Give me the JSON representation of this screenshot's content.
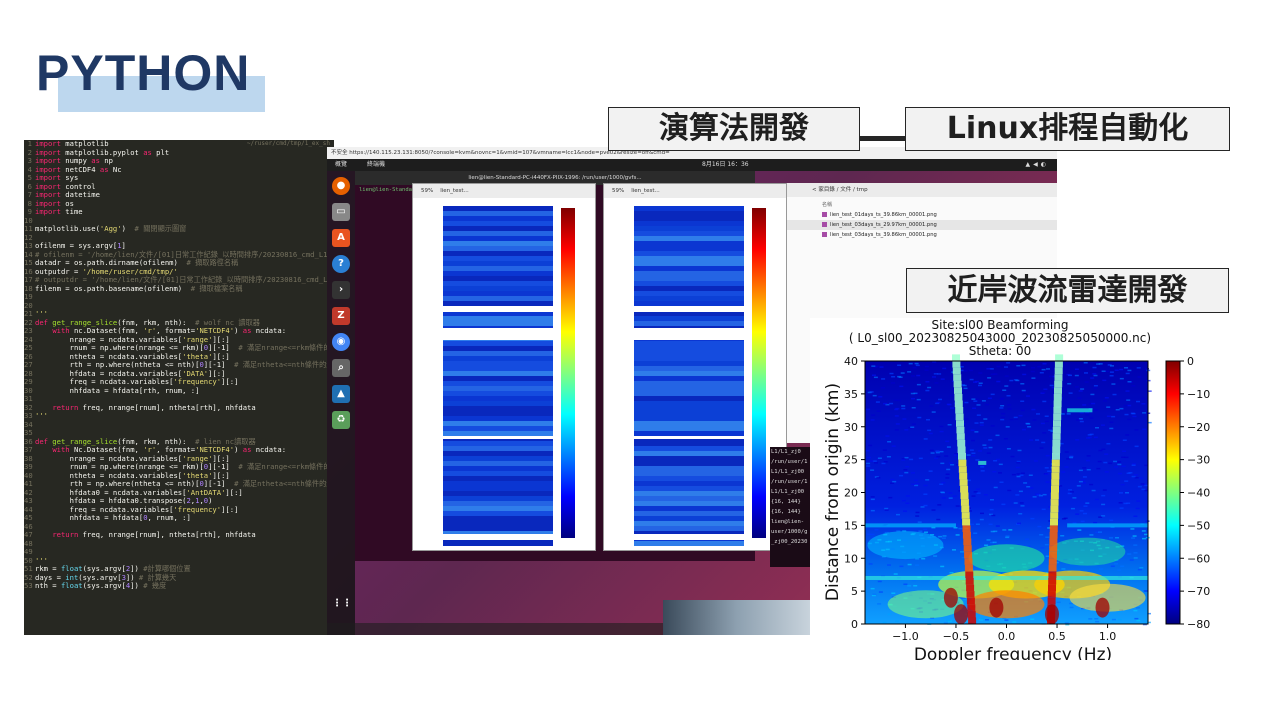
{
  "slide": {
    "title": "PYTHON",
    "labels": {
      "algorithm": "演算法開發",
      "linux_cron": "Linux排程自動化",
      "radar": "近岸波流雷達開發"
    }
  },
  "editor": {
    "header": "~/ruser/cmd/tmp/1_ex_sh",
    "lines": [
      [
        [
          "kw",
          "import"
        ],
        [
          "tx",
          " matplotlib"
        ]
      ],
      [
        [
          "kw",
          "import"
        ],
        [
          "tx",
          " matplotlib.pyplot "
        ],
        [
          "kw",
          "as"
        ],
        [
          "tx",
          " plt"
        ]
      ],
      [
        [
          "kw",
          "import"
        ],
        [
          "tx",
          " numpy "
        ],
        [
          "kw",
          "as"
        ],
        [
          "tx",
          " np"
        ]
      ],
      [
        [
          "kw",
          "import"
        ],
        [
          "tx",
          " netCDF4 "
        ],
        [
          "kw",
          "as"
        ],
        [
          "tx",
          " Nc"
        ]
      ],
      [
        [
          "kw",
          "import"
        ],
        [
          "tx",
          " sys"
        ]
      ],
      [
        [
          "kw",
          "import"
        ],
        [
          "tx",
          " control"
        ]
      ],
      [
        [
          "kw",
          "import"
        ],
        [
          "tx",
          " datetime"
        ]
      ],
      [
        [
          "kw",
          "import"
        ],
        [
          "tx",
          " os"
        ]
      ],
      [
        [
          "kw",
          "import"
        ],
        [
          "tx",
          " time"
        ]
      ],
      [
        [
          "tx",
          ""
        ]
      ],
      [
        [
          "tx",
          "matplotlib.use("
        ],
        [
          "str",
          "'Agg'"
        ],
        [
          "tx",
          ")  "
        ],
        [
          "cm",
          "# 關閉顯示圖窗"
        ]
      ],
      [
        [
          "tx",
          ""
        ]
      ],
      [
        [
          "tx",
          "ofilenm = sys.argv["
        ],
        [
          "nb",
          "1"
        ],
        [
          "tx",
          "]"
        ]
      ],
      [
        [
          "cm",
          "# ofilenm = '/home/lien/文件/[01]日常工作紀錄_以時間排序/20230816_cmd_L1_SL"
        ]
      ],
      [
        [
          "tx",
          "datadr = os.path.dirname(ofilenm)  "
        ],
        [
          "cm",
          "# 擷取路徑名稱"
        ]
      ],
      [
        [
          "tx",
          "outputdr = "
        ],
        [
          "str",
          "'/home/ruser/cmd/tmp/'"
        ]
      ],
      [
        [
          "cm",
          "# outputdr = '/home/lien/文件/[01]日常工作紀錄_以時間排序/20230816_cmd_L1_S"
        ]
      ],
      [
        [
          "tx",
          "filenm = os.path.basename(ofilenm)  "
        ],
        [
          "cm",
          "# 擷取檔案名稱"
        ]
      ],
      [
        [
          "tx",
          ""
        ]
      ],
      [
        [
          "tx",
          ""
        ]
      ],
      [
        [
          "str",
          "'''"
        ]
      ],
      [
        [
          "kw",
          "def"
        ],
        [
          "fn",
          " get_range_slice"
        ],
        [
          "tx",
          "(fnm, rkm, nth):  "
        ],
        [
          "cm",
          "# wolf nc 讀取器"
        ]
      ],
      [
        [
          "tx",
          "    "
        ],
        [
          "kw",
          "with"
        ],
        [
          "tx",
          " nc.Dataset(fnm, "
        ],
        [
          "str",
          "'r'"
        ],
        [
          "tx",
          ", format="
        ],
        [
          "str",
          "'NETCDF4'"
        ],
        [
          "tx",
          ") "
        ],
        [
          "kw",
          "as"
        ],
        [
          "tx",
          " ncdata:"
        ]
      ],
      [
        [
          "tx",
          "        nrange = ncdata.variables["
        ],
        [
          "str",
          "'range'"
        ],
        [
          "tx",
          "][:]"
        ]
      ],
      [
        [
          "tx",
          "        rnum = np.where(nrange <= rkm)["
        ],
        [
          "nb",
          "0"
        ],
        [
          "tx",
          "][-1]  "
        ],
        [
          "cm",
          "# 滿足nrange<=rkm條件的最"
        ]
      ],
      [
        [
          "tx",
          "        ntheta = ncdata.variables["
        ],
        [
          "str",
          "'theta'"
        ],
        [
          "tx",
          "][:]"
        ]
      ],
      [
        [
          "tx",
          "        rth = np.where(ntheta <= nth)["
        ],
        [
          "nb",
          "0"
        ],
        [
          "tx",
          "][-1]  "
        ],
        [
          "cm",
          "# 滿足ntheta<=nth條件的最後"
        ]
      ],
      [
        [
          "tx",
          "        hfdata = ncdata.variables["
        ],
        [
          "str",
          "'DATA'"
        ],
        [
          "tx",
          "][:]"
        ]
      ],
      [
        [
          "tx",
          "        freq = ncdata.variables["
        ],
        [
          "str",
          "'frequency'"
        ],
        [
          "tx",
          "][:]"
        ]
      ],
      [
        [
          "tx",
          "        nhfdata = hfdata[rth, rnum, :]"
        ]
      ],
      [
        [
          "tx",
          ""
        ]
      ],
      [
        [
          "tx",
          "    "
        ],
        [
          "kw",
          "return"
        ],
        [
          "tx",
          " freq, nrange[rnum], ntheta[rth], nhfdata"
        ]
      ],
      [
        [
          "str",
          "'''"
        ]
      ],
      [
        [
          "tx",
          ""
        ]
      ],
      [
        [
          "tx",
          ""
        ]
      ],
      [
        [
          "kw",
          "def"
        ],
        [
          "fn",
          " get_range_slice"
        ],
        [
          "tx",
          "(fnm, rkm, nth):  "
        ],
        [
          "cm",
          "# lien nc讀取器"
        ]
      ],
      [
        [
          "tx",
          "    "
        ],
        [
          "kw",
          "with"
        ],
        [
          "tx",
          " Nc.Dataset(fnm, "
        ],
        [
          "str",
          "'r'"
        ],
        [
          "tx",
          ", format="
        ],
        [
          "str",
          "'NETCDF4'"
        ],
        [
          "tx",
          ") "
        ],
        [
          "kw",
          "as"
        ],
        [
          "tx",
          " ncdata:"
        ]
      ],
      [
        [
          "tx",
          "        nrange = ncdata.variables["
        ],
        [
          "str",
          "'range'"
        ],
        [
          "tx",
          "][:]"
        ]
      ],
      [
        [
          "tx",
          "        rnum = np.where(nrange <= rkm)["
        ],
        [
          "nb",
          "0"
        ],
        [
          "tx",
          "][-1]  "
        ],
        [
          "cm",
          "# 滿足nrange<=rkm條件的最後"
        ]
      ],
      [
        [
          "tx",
          "        ntheta = ncdata.variables["
        ],
        [
          "str",
          "'theta'"
        ],
        [
          "tx",
          "][:]"
        ]
      ],
      [
        [
          "tx",
          "        rth = np.where(ntheta <= nth)["
        ],
        [
          "nb",
          "0"
        ],
        [
          "tx",
          "][-1]  "
        ],
        [
          "cm",
          "# 滿足ntheta<=nth條件的最後一"
        ]
      ],
      [
        [
          "tx",
          "        hfdata0 = ncdata.variables["
        ],
        [
          "str",
          "'AntDATA'"
        ],
        [
          "tx",
          "][:]"
        ]
      ],
      [
        [
          "tx",
          "        hfdata = hfdata0.transpose("
        ],
        [
          "nb",
          "2"
        ],
        [
          "tx",
          ","
        ],
        [
          "nb",
          "1"
        ],
        [
          "tx",
          ","
        ],
        [
          "nb",
          "0"
        ],
        [
          "tx",
          ")"
        ]
      ],
      [
        [
          "tx",
          "        freq = ncdata.variables["
        ],
        [
          "str",
          "'frequency'"
        ],
        [
          "tx",
          "][:]"
        ]
      ],
      [
        [
          "tx",
          "        nhfdata = hfdata["
        ],
        [
          "nb",
          "0"
        ],
        [
          "tx",
          ", rnum, :]"
        ]
      ],
      [
        [
          "tx",
          ""
        ]
      ],
      [
        [
          "tx",
          "    "
        ],
        [
          "kw",
          "return"
        ],
        [
          "tx",
          " freq, nrange[rnum], ntheta[rth], nhfdata"
        ]
      ],
      [
        [
          "tx",
          ""
        ]
      ],
      [
        [
          "tx",
          ""
        ]
      ],
      [
        [
          "str",
          "'''"
        ]
      ],
      [
        [
          "tx",
          "rkm = "
        ],
        [
          "bl",
          "float"
        ],
        [
          "tx",
          "(sys.argv["
        ],
        [
          "nb",
          "2"
        ],
        [
          "tx",
          "]) "
        ],
        [
          "cm",
          "#計算哪個位置"
        ]
      ],
      [
        [
          "tx",
          "days = "
        ],
        [
          "bl",
          "int"
        ],
        [
          "tx",
          "(sys.argv["
        ],
        [
          "nb",
          "3"
        ],
        [
          "tx",
          "]) "
        ],
        [
          "cm",
          "# 計算幾天"
        ]
      ],
      [
        [
          "tx",
          "nth = "
        ],
        [
          "bl",
          "float"
        ],
        [
          "tx",
          "(sys.argv["
        ],
        [
          "nb",
          "4"
        ],
        [
          "tx",
          "]) "
        ],
        [
          "cm",
          "# 幾度"
        ]
      ]
    ]
  },
  "desktop": {
    "browser_url": "不安全  https://140.115.23.131:8050/?console=kvm&novnc=1&vmid=107&vmname=lcc1&node=pve02&resize=off&cmd=",
    "activities": "概覽",
    "terminal_app": "終端機",
    "clock": "8月16日 16：36",
    "terminal_title": "lien@lien-Standard-PC-i440FX-PIIX-1996: /run/user/1000/gvfs...",
    "terminal_prompt": "lien@lien-Standard-PC-i440FX",
    "filemgr_path": "< 家目錄 / 文件 / tmp",
    "filemgr_col": "名稱",
    "files": [
      "lien_test_01days_ts_39.86km_00001.png",
      "lien_test_03days_ts_29.97km_00001.png",
      "lien_test_03days_ts_39.86km_00001.png"
    ],
    "viewer_zoom": "59%",
    "viewer_title": "lien_test...",
    "mini_terminal_lines": [
      "L1/L1_zj0",
      "/run/user/1",
      "L1/L1_zj00",
      "/run/user/1",
      "L1/L1_zj00",
      "{16, 144}",
      "{16, 144}",
      "lien@lien-",
      "user/1000/g",
      "_zj00_20230"
    ]
  },
  "chart_data": {
    "type": "heatmap",
    "title": "Site:sl00  Beamforming",
    "subtitle": "( L0_sl00_20230825043000_20230825050000.nc)",
    "subtitle2": "Stheta: 00",
    "xlabel": "Doppler frequency (Hz)",
    "ylabel": "Distance from origin (km)",
    "xlim": [
      -1.4,
      1.4
    ],
    "ylim": [
      0,
      40
    ],
    "xticks": [
      -1.0,
      -0.5,
      0.0,
      0.5,
      1.0
    ],
    "xtick_labels": [
      "−1.0",
      "−0.5",
      "0.0",
      "0.5",
      "1.0"
    ],
    "yticks": [
      0,
      5,
      10,
      15,
      20,
      25,
      30,
      35,
      40
    ],
    "colorbar": {
      "min": -80,
      "max": 0,
      "ticks": [
        0,
        -10,
        -20,
        -30,
        -40,
        -50,
        -60,
        -70,
        -80
      ],
      "tick_labels": [
        "0",
        "−10",
        "−20",
        "−30",
        "−40",
        "−50",
        "−60",
        "−70",
        "−80"
      ],
      "colormap": "jet"
    },
    "bragg_peaks_hz": [
      -0.5,
      0.48
    ]
  }
}
